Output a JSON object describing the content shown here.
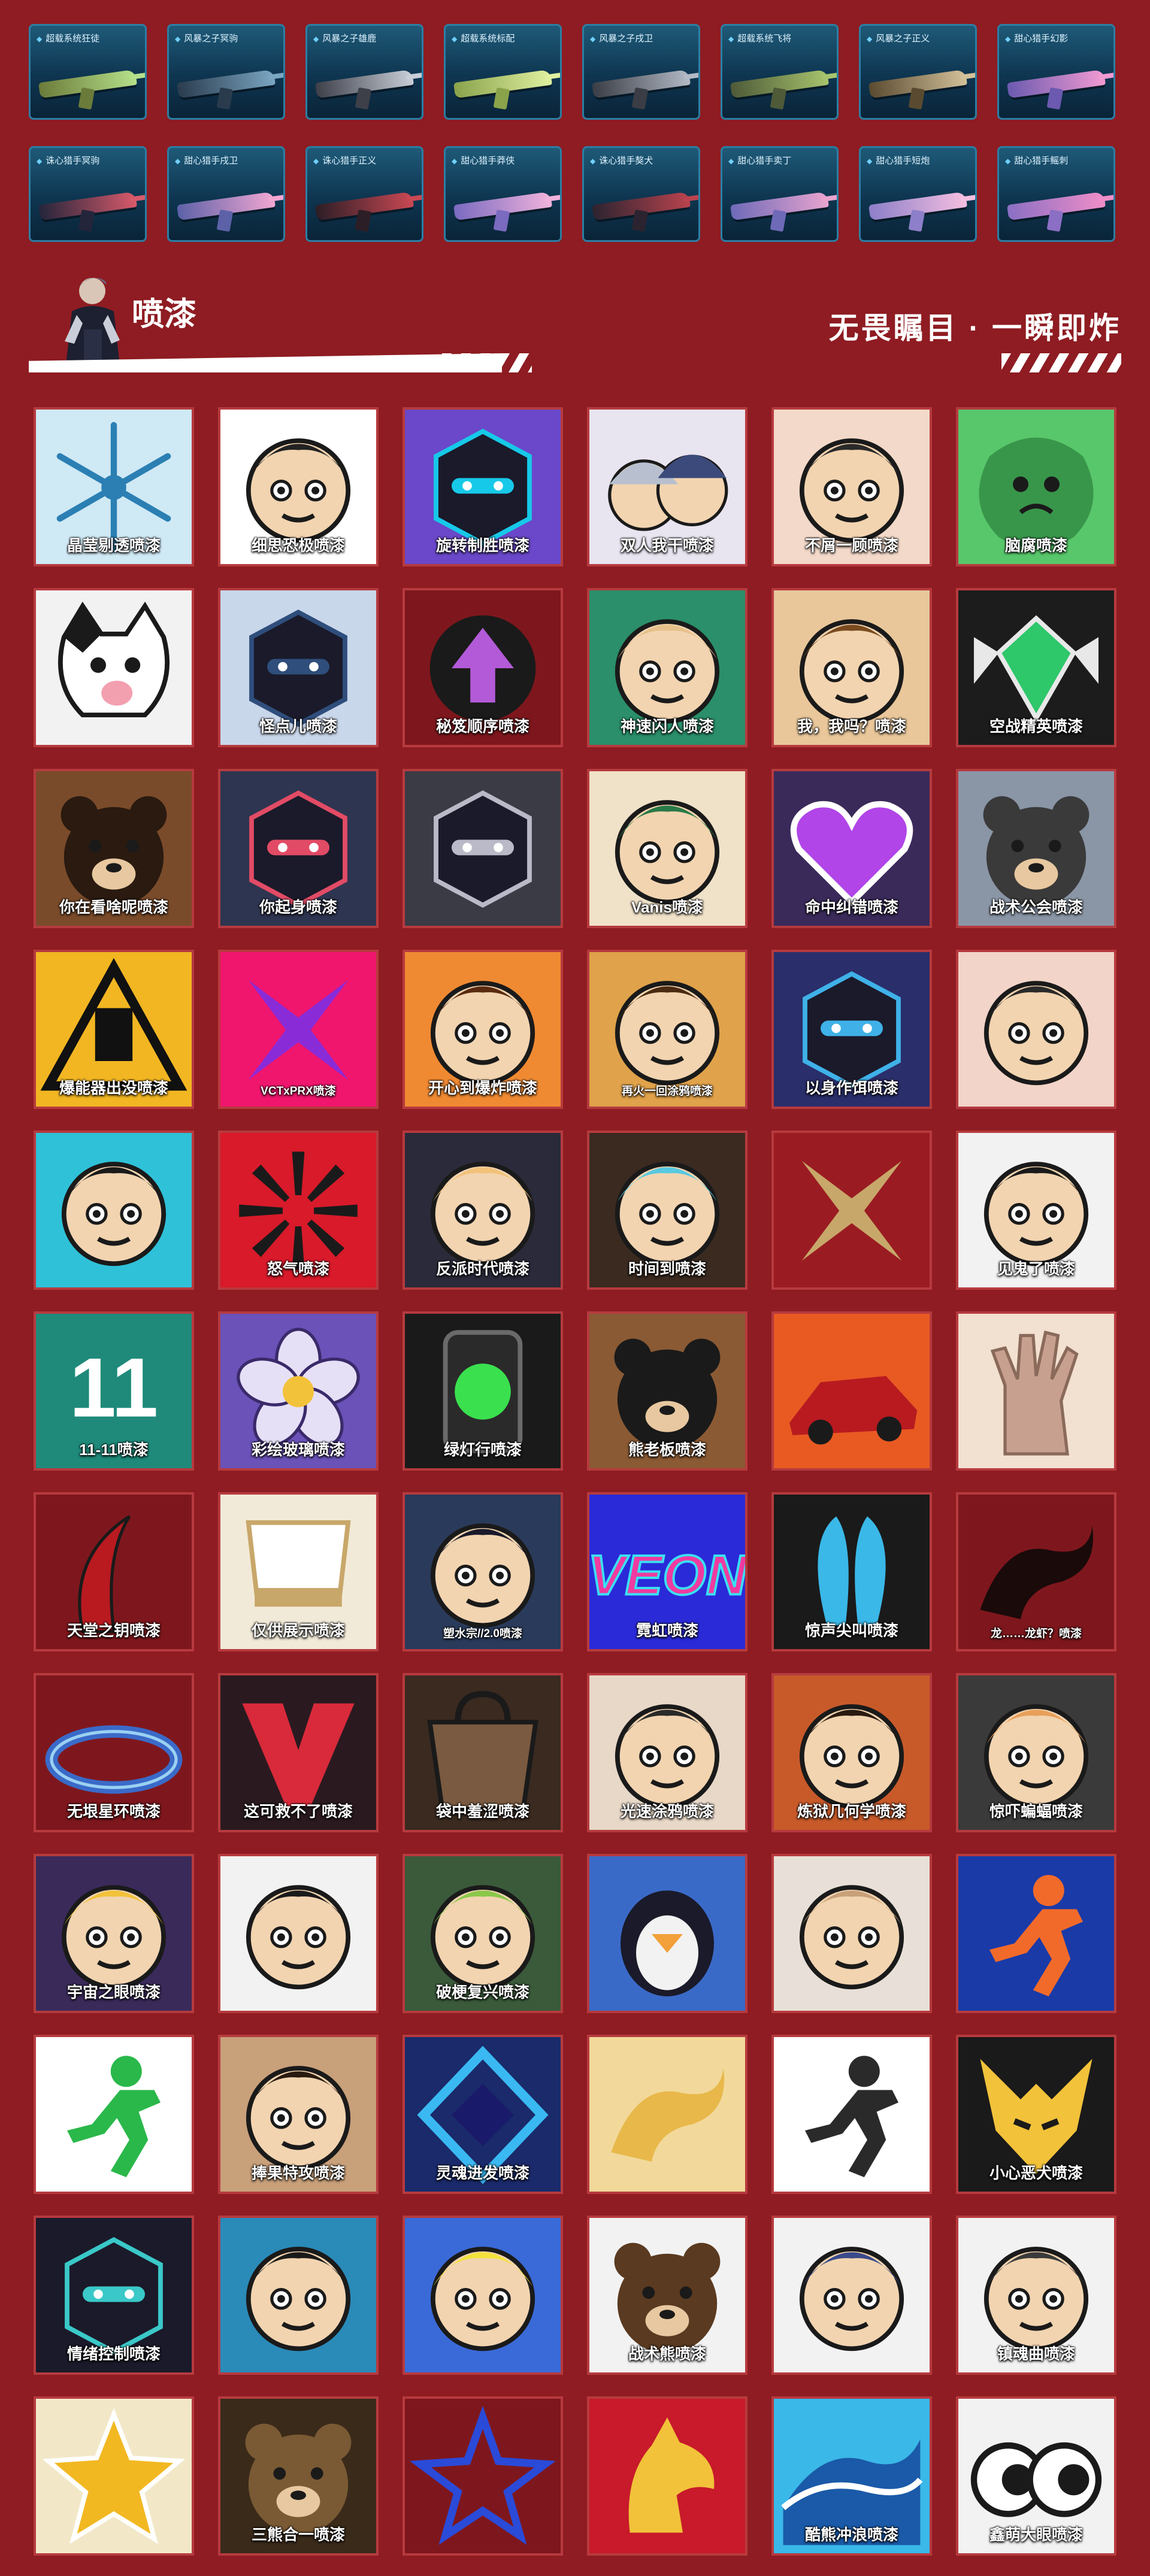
{
  "weapon_skins": [
    {
      "name": "超载系统狂徒",
      "c1": "#6b7b3a",
      "c2": "#b6e08a"
    },
    {
      "name": "风暴之子冥驹",
      "c1": "#2a3b4d",
      "c2": "#7aa6c2"
    },
    {
      "name": "风暴之子雄鹿",
      "c1": "#3d3f49",
      "c2": "#c9cfd8"
    },
    {
      "name": "超载系统标配",
      "c1": "#8aa34b",
      "c2": "#e0f0a0"
    },
    {
      "name": "风暴之子戌卫",
      "c1": "#3a3d45",
      "c2": "#b3bac6"
    },
    {
      "name": "超载系统飞将",
      "c1": "#4e5a38",
      "c2": "#a7c46d"
    },
    {
      "name": "风暴之子正义",
      "c1": "#5a4a30",
      "c2": "#d3c19a"
    },
    {
      "name": "甜心猎手幻影",
      "c1": "#6b5ab0",
      "c2": "#f29ad2"
    },
    {
      "name": "诛心猎手冥驹",
      "c1": "#23253b",
      "c2": "#d85a6b"
    },
    {
      "name": "甜心猎手戌卫",
      "c1": "#5c61a8",
      "c2": "#f2a7d2"
    },
    {
      "name": "诛心猎手正义",
      "c1": "#2c1e26",
      "c2": "#c94853"
    },
    {
      "name": "甜心猎手莽侠",
      "c1": "#7a6ac0",
      "c2": "#f0b3dc"
    },
    {
      "name": "诛心猎手獒犬",
      "c1": "#2b2430",
      "c2": "#b9434e"
    },
    {
      "name": "甜心猎手卖丁",
      "c1": "#6e6ab8",
      "c2": "#e8a4cf"
    },
    {
      "name": "甜心猎手短炮",
      "c1": "#8d7fc9",
      "c2": "#f5bfe0"
    },
    {
      "name": "甜心猎手鳐刺",
      "c1": "#8b6fc4",
      "c2": "#ef8ec8"
    }
  ],
  "section": {
    "title": "喷漆",
    "slogan": "无畏瞩目 · 一瞬即炸"
  },
  "sprays": [
    {
      "label": "晶莹剔透喷漆",
      "bg": "#cfe9f5",
      "fg": "#2b7fb3",
      "icon": "snowflake"
    },
    {
      "label": "细思恐极喷漆",
      "bg": "#ffffff",
      "fg": "#222222",
      "icon": "face"
    },
    {
      "label": "旋转制胜喷漆",
      "bg": "#6a48c9",
      "fg": "#17c9e8",
      "icon": "robot"
    },
    {
      "label": "双人我干喷漆",
      "bg": "#e8e4f0",
      "fg": "#3b4a7a",
      "icon": "duo"
    },
    {
      "label": "不屑一顾喷漆",
      "bg": "#f3d9c9",
      "fg": "#2a2a2a",
      "icon": "face"
    },
    {
      "label": "脑腐喷漆",
      "bg": "#58c76b",
      "fg": "#1f6e2f",
      "icon": "blob"
    },
    {
      "label": "",
      "bg": "#f2f2f2",
      "fg": "#333333",
      "icon": "cat"
    },
    {
      "label": "怪点儿喷漆",
      "bg": "#c9d7ea",
      "fg": "#2f4e7c",
      "icon": "robot"
    },
    {
      "label": "秘笈顺序喷漆",
      "bg": "#7e171d",
      "fg": "#b35ad8",
      "icon": "arrow"
    },
    {
      "label": "神速闪人喷漆",
      "bg": "#2a8f6a",
      "fg": "#e6c08a",
      "icon": "face"
    },
    {
      "label": "我，我吗？喷漆",
      "bg": "#e9c79a",
      "fg": "#7a4b1f",
      "icon": "face"
    },
    {
      "label": "空战精英喷漆",
      "bg": "#1c1c1c",
      "fg": "#2ec76a",
      "icon": "gem"
    },
    {
      "label": "你在看啥呢喷漆",
      "bg": "#7a4b2a",
      "fg": "#2a1a10",
      "icon": "bear"
    },
    {
      "label": "你起身喷漆",
      "bg": "#2e3550",
      "fg": "#e24b65",
      "icon": "robot"
    },
    {
      "label": "",
      "bg": "#3b3b45",
      "fg": "#b9b9c7",
      "icon": "robot"
    },
    {
      "label": "Vanis喷漆",
      "bg": "#f0e2c8",
      "fg": "#2a7a48",
      "icon": "face"
    },
    {
      "label": "命中纠错喷漆",
      "bg": "#3a2a5a",
      "fg": "#b145e8",
      "icon": "heart"
    },
    {
      "label": "战术公会喷漆",
      "bg": "#8a96a6",
      "fg": "#3a3a3a",
      "icon": "bear"
    },
    {
      "label": "爆能器出没喷漆",
      "bg": "#f2b622",
      "fg": "#111111",
      "icon": "hazard"
    },
    {
      "label": "VCTxPRX喷漆",
      "bg": "#f0166e",
      "fg": "#8a2bd8",
      "icon": "x"
    },
    {
      "label": "开心到爆炸喷漆",
      "bg": "#f08a32",
      "fg": "#5a2a10",
      "icon": "face"
    },
    {
      "label": "再火一回涂鸦喷漆",
      "bg": "#e0a24a",
      "fg": "#4a2a10",
      "icon": "face"
    },
    {
      "label": "以身作饵喷漆",
      "bg": "#2a2e6a",
      "fg": "#3fb1e8",
      "icon": "robot"
    },
    {
      "label": "",
      "bg": "#f2d4c8",
      "fg": "#2a2a2a",
      "icon": "face"
    },
    {
      "label": "",
      "bg": "#2fc1d8",
      "fg": "#1a1a1a",
      "icon": "face"
    },
    {
      "label": "怒气喷漆",
      "bg": "#d81a2a",
      "fg": "#1a1a1a",
      "icon": "burst"
    },
    {
      "label": "反派时代喷漆",
      "bg": "#2a2a3a",
      "fg": "#f2c27a",
      "icon": "face"
    },
    {
      "label": "时间到喷漆",
      "bg": "#3a2a20",
      "fg": "#58c9e0",
      "icon": "face"
    },
    {
      "label": "",
      "bg": "#9a1c22",
      "fg": "#c8a76a",
      "icon": "x"
    },
    {
      "label": "见鬼了喷漆",
      "bg": "#f2f2f2",
      "fg": "#1a1a1a",
      "icon": "face"
    },
    {
      "label": "11-11喷漆",
      "bg": "#1f8a7a",
      "fg": "#ffffff",
      "icon": "eleven"
    },
    {
      "label": "彩绘玻璃喷漆",
      "bg": "#6a52b8",
      "fg": "#e6e0f7",
      "icon": "flower"
    },
    {
      "label": "绿灯行喷漆",
      "bg": "#1a1a1a",
      "fg": "#3ae04e",
      "icon": "light"
    },
    {
      "label": "熊老板喷漆",
      "bg": "#8a5a34",
      "fg": "#1a1a1a",
      "icon": "bear"
    },
    {
      "label": "",
      "bg": "#e85a22",
      "fg": "#b81a20",
      "icon": "car"
    },
    {
      "label": "",
      "bg": "#f2e0d0",
      "fg": "#c8a090",
      "icon": "hand"
    },
    {
      "label": "天堂之钥喷漆",
      "bg": "#7e171d",
      "fg": "#b81a20",
      "icon": "sickle"
    },
    {
      "label": "仅供展示喷漆",
      "bg": "#f2ead8",
      "fg": "#c8a76a",
      "icon": "cup"
    },
    {
      "label": "塑水宗//2.0喷漆",
      "bg": "#2a3a5a",
      "fg": "#1a1a2a",
      "icon": "face"
    },
    {
      "label": "霓虹喷漆",
      "bg": "#2a2ad8",
      "fg": "#f03aa0",
      "icon": "neon"
    },
    {
      "label": "惊声尖叫喷漆",
      "bg": "#1a1a1a",
      "fg": "#3ab8e8",
      "icon": "scream"
    },
    {
      "label": "龙……龙虾？喷漆",
      "bg": "#7e171d",
      "fg": "#1a0a0a",
      "icon": "dragon"
    },
    {
      "label": "无垠星环喷漆",
      "bg": "#7e171d",
      "fg": "#3a6ac8",
      "icon": "ring"
    },
    {
      "label": "这可救不了喷漆",
      "bg": "#2a1a20",
      "fg": "#d82a3a",
      "icon": "v"
    },
    {
      "label": "袋中羞涩喷漆",
      "bg": "#3a2a20",
      "fg": "#7a5a40",
      "icon": "bag"
    },
    {
      "label": "光速涂鸦喷漆",
      "bg": "#e8d8c8",
      "fg": "#2a2a2a",
      "icon": "face"
    },
    {
      "label": "炼狱几何学喷漆",
      "bg": "#c85a2a",
      "fg": "#2a1a10",
      "icon": "face"
    },
    {
      "label": "惊吓蝙蝠喷漆",
      "bg": "#3a3a3a",
      "fg": "#e8a05a",
      "icon": "face"
    },
    {
      "label": "宇宙之眼喷漆",
      "bg": "#3a2a5a",
      "fg": "#f2c23a",
      "icon": "face"
    },
    {
      "label": "",
      "bg": "#f2f2f2",
      "fg": "#1a1a1a",
      "icon": "face"
    },
    {
      "label": "破梗复兴喷漆",
      "bg": "#3a5a3a",
      "fg": "#8ac84a",
      "icon": "face"
    },
    {
      "label": "",
      "bg": "#3a6ac8",
      "fg": "#f2f2f2",
      "icon": "penguin"
    },
    {
      "label": "",
      "bg": "#e8e0d8",
      "fg": "#c8a07a",
      "icon": "face"
    },
    {
      "label": "",
      "bg": "#1a3aa8",
      "fg": "#f26a2a",
      "icon": "run"
    },
    {
      "label": "",
      "bg": "#ffffff",
      "fg": "#2ab84a",
      "icon": "run"
    },
    {
      "label": "捧果特攻喷漆",
      "bg": "#c8a07a",
      "fg": "#2a1a10",
      "icon": "face"
    },
    {
      "label": "灵魂进发喷漆",
      "bg": "#1a2a6a",
      "fg": "#3ab8f2",
      "icon": "diamond"
    },
    {
      "label": "",
      "bg": "#f2d89a",
      "fg": "#e8b84a",
      "icon": "dragon"
    },
    {
      "label": "",
      "bg": "#ffffff",
      "fg": "#2a2a2a",
      "icon": "run"
    },
    {
      "label": "小心恶犬喷漆",
      "bg": "#1a1a1a",
      "fg": "#f2c23a",
      "icon": "wolf"
    },
    {
      "label": "情绪控制喷漆",
      "bg": "#1a1a2a",
      "fg": "#3ac8c8",
      "icon": "robot"
    },
    {
      "label": "",
      "bg": "#2a8ab8",
      "fg": "#1a1a1a",
      "icon": "face"
    },
    {
      "label": "",
      "bg": "#3a6ad8",
      "fg": "#f2e23a",
      "icon": "face"
    },
    {
      "label": "战术熊喷漆",
      "bg": "#f2f2f2",
      "fg": "#5a3a20",
      "icon": "bear"
    },
    {
      "label": "",
      "bg": "#f2f2f2",
      "fg": "#3a4a8a",
      "icon": "face"
    },
    {
      "label": "镇魂曲喷漆",
      "bg": "#f2f2f2",
      "fg": "#3a3a3a",
      "icon": "face"
    },
    {
      "label": "",
      "bg": "#f2e8c8",
      "fg": "#f2b822",
      "icon": "star"
    },
    {
      "label": "三熊合一喷漆",
      "bg": "#3a2a1a",
      "fg": "#7a5a34",
      "icon": "bear"
    },
    {
      "label": "",
      "bg": "#7e171d",
      "fg": "#2a4ad8",
      "icon": "starline"
    },
    {
      "label": "",
      "bg": "#c81a2a",
      "fg": "#f2c23a",
      "icon": "horse"
    },
    {
      "label": "酷熊冲浪喷漆",
      "bg": "#3ab8e8",
      "fg": "#1a5aa8",
      "icon": "wave"
    },
    {
      "label": "鑫萌大眼喷漆",
      "bg": "#f2f2f2",
      "fg": "#1a1a1a",
      "icon": "eyes"
    }
  ]
}
